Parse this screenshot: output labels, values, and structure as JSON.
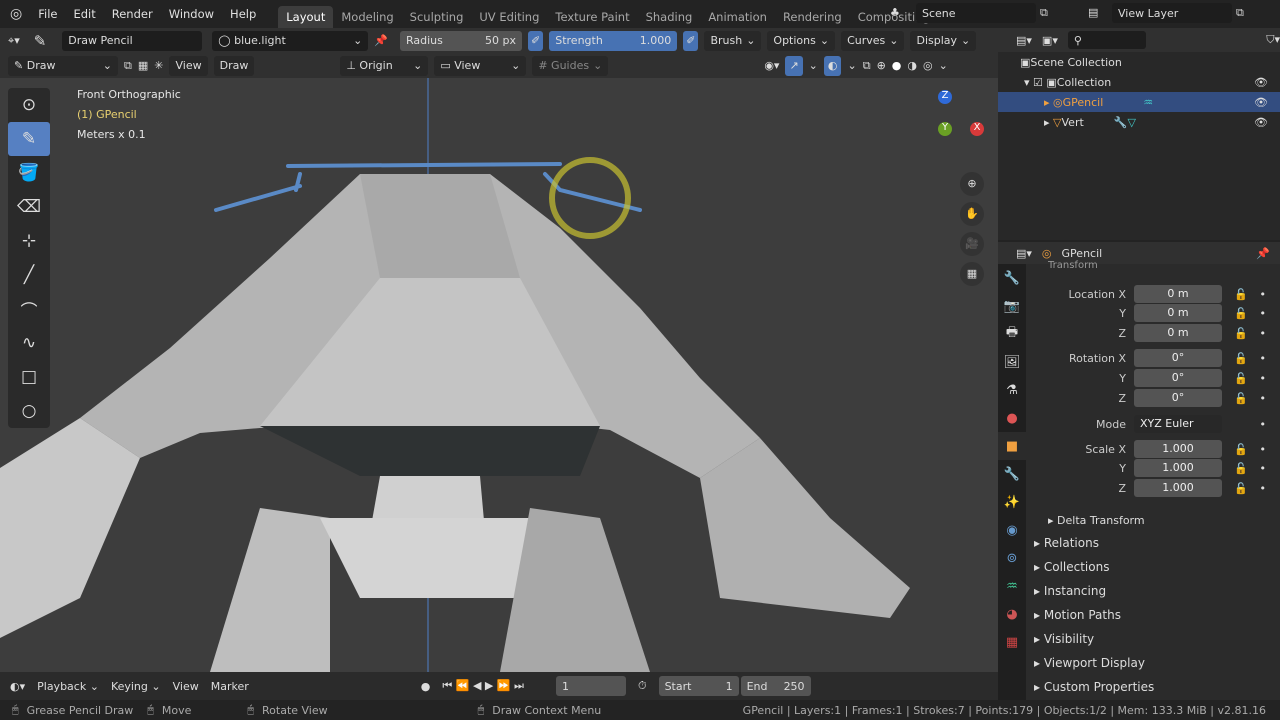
{
  "menu": [
    "File",
    "Edit",
    "Render",
    "Window",
    "Help"
  ],
  "workspaces": [
    "Layout",
    "Modeling",
    "Sculpting",
    "UV Editing",
    "Texture Paint",
    "Shading",
    "Animation",
    "Rendering",
    "Compositing"
  ],
  "scene": "Scene",
  "view_layer": "View Layer",
  "tool_header": {
    "brush": "Draw Pencil",
    "material": "blue.light",
    "radius_label": "Radius",
    "radius_value": "50 px",
    "strength_label": "Strength",
    "strength_value": "1.000",
    "strength_fraction": 1.0,
    "brush_menu": "Brush",
    "options": "Options",
    "curves": "Curves",
    "display": "Display"
  },
  "header2": {
    "mode": "Draw",
    "view": "View",
    "draw": "Draw",
    "origin": "Origin",
    "view_dd": "View",
    "guides": "Guides"
  },
  "viewport": {
    "view_name": "Front Orthographic",
    "object": "(1) GPencil",
    "units": "Meters x 0.1",
    "axes": [
      "Z",
      "Y",
      "X"
    ]
  },
  "outliner": {
    "items": [
      {
        "label": "Scene Collection"
      },
      {
        "label": "Collection"
      },
      {
        "label": "GPencil",
        "selected": true
      },
      {
        "label": "Vert"
      }
    ]
  },
  "properties": {
    "object_name": "GPencil",
    "section": "Transform",
    "rows": [
      {
        "label": "Location X",
        "value": "0 m"
      },
      {
        "label": "Y",
        "value": "0 m"
      },
      {
        "label": "Z",
        "value": "0 m"
      },
      {
        "label": "Rotation X",
        "value": "0°"
      },
      {
        "label": "Y",
        "value": "0°"
      },
      {
        "label": "Z",
        "value": "0°"
      },
      {
        "label": "Mode",
        "value": "XYZ Euler"
      },
      {
        "label": "Scale X",
        "value": "1.000"
      },
      {
        "label": "Y",
        "value": "1.000"
      },
      {
        "label": "Z",
        "value": "1.000"
      }
    ],
    "subpanel": "Delta Transform",
    "panels": [
      "Relations",
      "Collections",
      "Instancing",
      "Motion Paths",
      "Visibility",
      "Viewport Display",
      "Custom Properties"
    ]
  },
  "timeline": {
    "playback": "Playback",
    "keying": "Keying",
    "view": "View",
    "marker": "Marker",
    "current_frame": "1",
    "start_label": "Start",
    "start": "1",
    "end_label": "End",
    "end": "250"
  },
  "status": {
    "left": "Grease Pencil Draw",
    "move": "Move",
    "rotate": "Rotate View",
    "context": "Draw Context Menu",
    "stats": "GPencil | Layers:1 | Frames:1 | Strokes:7 | Points:179 | Objects:1/2 | Mem: 133.3 MiB | v2.81.16"
  },
  "colors": {
    "accent": "#5680c2",
    "stroke": "#5a8ac6",
    "cursor": "#c8c030"
  }
}
